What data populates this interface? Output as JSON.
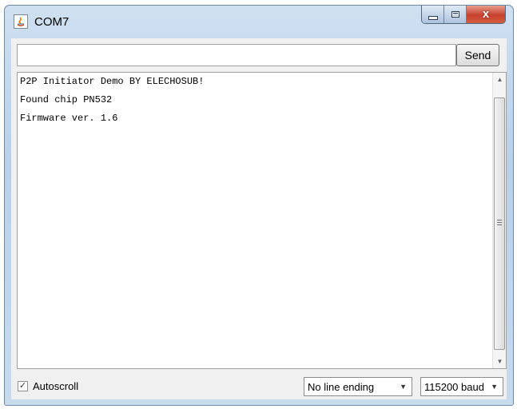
{
  "window": {
    "title": "COM7",
    "app_icon": "java-icon",
    "caption_buttons": {
      "minimize": "minimize-icon",
      "maximize": "maximize-icon",
      "close": "x"
    }
  },
  "input": {
    "value": "",
    "placeholder": ""
  },
  "send_label": "Send",
  "output": {
    "lines": [
      "P2P Initiator Demo BY ELECHOSUB!",
      "Found chip PN532",
      "Firmware ver. 1.6"
    ]
  },
  "bottom": {
    "autoscroll_label": "Autoscroll",
    "autoscroll_checked": true,
    "line_ending": "No line ending",
    "baud": "115200 baud"
  }
}
